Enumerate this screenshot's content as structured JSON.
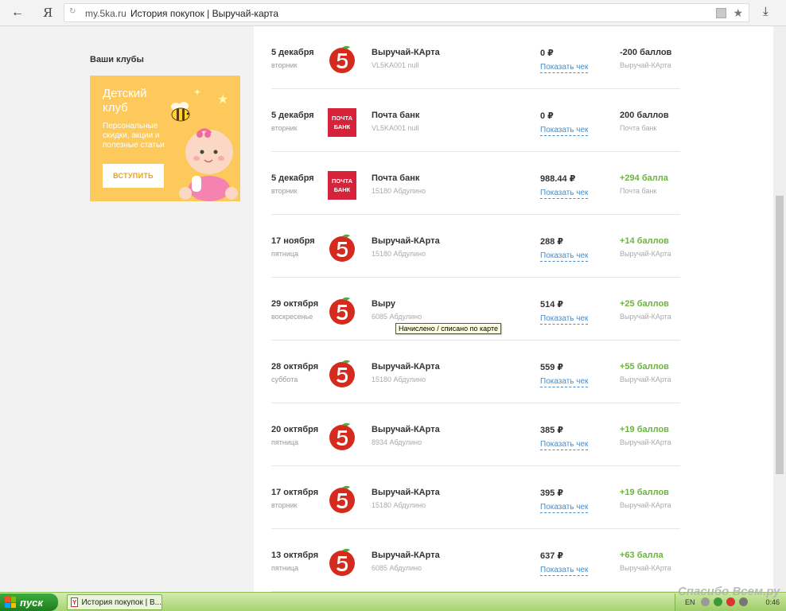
{
  "browser": {
    "url_host": "my.5ka.ru",
    "tab_title": "История покупок | Выручай-карта",
    "ya_label": "Я"
  },
  "sidebar": {
    "clubs_title": "Ваши клубы",
    "club": {
      "name": "Детский клуб",
      "description": "Персональные скидки, акции и полезные статьи",
      "join_label": "ВСТУПИТЬ"
    }
  },
  "colors": {
    "accent_green": "#6db33f",
    "link_blue": "#4a8cc7",
    "pyaterochka_red": "#d52b1e",
    "pochta_red": "#d4233a",
    "club_yellow": "#fcc95a"
  },
  "tooltip": "Начислено / списано по карте",
  "check_link_label": "Показать чек",
  "transactions": [
    {
      "date": "5 декабря",
      "weekday": "вторник",
      "logo": "pyaterochka-logo",
      "merchant": "Выручай-КАрта",
      "store": "VL5KA001 null",
      "amount": "0 ₽",
      "points": "-200 баллов",
      "points_positive": false,
      "source": "Выручай-КАрта"
    },
    {
      "date": "5 декабря",
      "weekday": "вторник",
      "logo": "pochta-bank-logo",
      "merchant": "Почта банк",
      "store": "VL5KA001 null",
      "amount": "0 ₽",
      "points": "200 баллов",
      "points_positive": false,
      "source": "Почта банк"
    },
    {
      "date": "5 декабря",
      "weekday": "вторник",
      "logo": "pochta-bank-logo",
      "merchant": "Почта банк",
      "store": "15180 Абдулино",
      "amount": "988.44 ₽",
      "points": "+294 балла",
      "points_positive": true,
      "source": "Почта банк"
    },
    {
      "date": "17 ноября",
      "weekday": "пятница",
      "logo": "pyaterochka-logo",
      "merchant": "Выручай-КАрта",
      "store": "15180 Абдулино",
      "amount": "288 ₽",
      "points": "+14 баллов",
      "points_positive": true,
      "source": "Выручай-КАрта"
    },
    {
      "date": "29 октября",
      "weekday": "воскресенье",
      "logo": "pyaterochka-logo",
      "merchant": "Выру",
      "store": "6085 Абдулино",
      "amount": "514 ₽",
      "points": "+25 баллов",
      "points_positive": true,
      "source": "Выручай-КАрта"
    },
    {
      "date": "28 октября",
      "weekday": "суббота",
      "logo": "pyaterochka-logo",
      "merchant": "Выручай-КАрта",
      "store": "15180 Абдулино",
      "amount": "559 ₽",
      "points": "+55 баллов",
      "points_positive": true,
      "source": "Выручай-КАрта"
    },
    {
      "date": "20 октября",
      "weekday": "пятница",
      "logo": "pyaterochka-logo",
      "merchant": "Выручай-КАрта",
      "store": "8934 Абдулино",
      "amount": "385 ₽",
      "points": "+19 баллов",
      "points_positive": true,
      "source": "Выручай-КАрта"
    },
    {
      "date": "17 октября",
      "weekday": "вторник",
      "logo": "pyaterochka-logo",
      "merchant": "Выручай-КАрта",
      "store": "15180 Абдулино",
      "amount": "395 ₽",
      "points": "+19 баллов",
      "points_positive": true,
      "source": "Выручай-КАрта"
    },
    {
      "date": "13 октября",
      "weekday": "пятница",
      "logo": "pyaterochka-logo",
      "merchant": "Выручай-КАрта",
      "store": "6085 Абдулино",
      "amount": "637 ₽",
      "points": "+63 балла",
      "points_positive": true,
      "source": "Выручай-КАрта"
    }
  ],
  "pochta_logo_text": {
    "line1": "ПОЧТА",
    "line2": "БАНК"
  },
  "taskbar": {
    "start_label": "пуск",
    "task_label": "История покупок | В...",
    "lang": "EN",
    "clock": "0:46"
  },
  "watermark": "Спасибо Всем.ру"
}
